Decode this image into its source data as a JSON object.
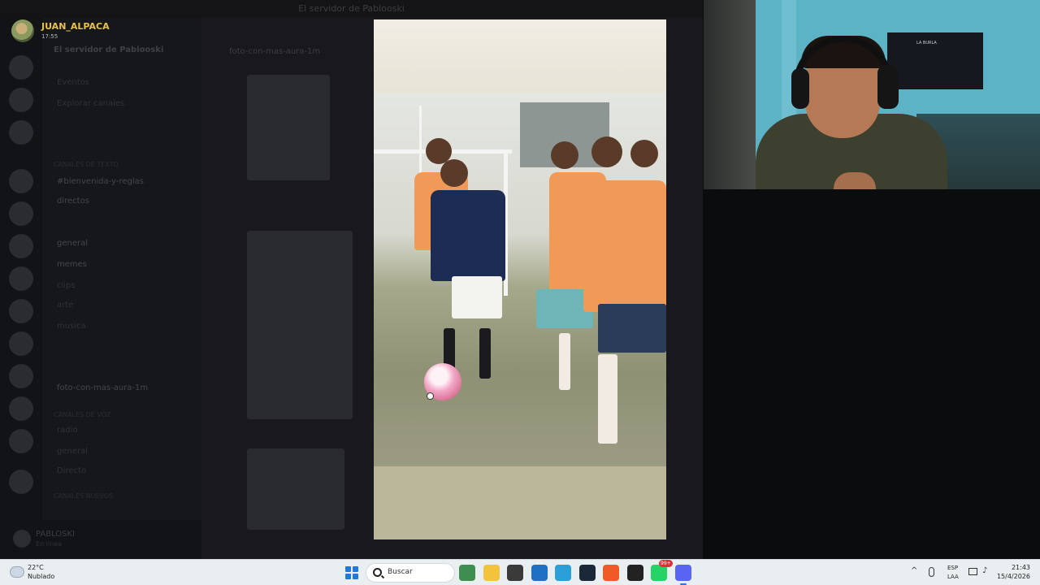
{
  "window": {
    "title": "El servidor de Pablooski"
  },
  "overlay_user": {
    "name": "JUAN_ALPACA",
    "time": "17:55"
  },
  "discord": {
    "server_name": "El servidor de Pablooski",
    "thread_title": "foto-con-mas-aura-1m",
    "categories": [
      "Canales de texto",
      "Canales de voz",
      "Canales nuevos"
    ],
    "channels": [
      {
        "label": "Eventos",
        "bright": false
      },
      {
        "label": "Explorar canales",
        "bright": false
      },
      {
        "label": "#bienvenida-y-reglas",
        "bright": true
      },
      {
        "label": "directos",
        "bright": true
      },
      {
        "label": "general",
        "bright": true
      },
      {
        "label": "memes",
        "bright": true
      },
      {
        "label": "clips",
        "bright": false
      },
      {
        "label": "arte",
        "bright": false
      },
      {
        "label": "musica",
        "bright": false
      },
      {
        "label": "foto-con-mas-aura-1m",
        "bright": true
      },
      {
        "label": "radio",
        "bright": false
      },
      {
        "label": "general",
        "bright": false
      },
      {
        "label": "Directo",
        "bright": false
      }
    ],
    "user": {
      "name": "PABLOSKI",
      "status": "En línea"
    }
  },
  "photo_viewer": {
    "scene": "youth soccer match photo",
    "colors": {
      "bib_orange": "#f19a58",
      "kit_navy": "#1d2c52",
      "field_green": "#8e9174"
    }
  },
  "webcam": {
    "flag_text": "LA BURLA"
  },
  "taskbar": {
    "weather": {
      "temp": "22°C",
      "desc": "Nublado"
    },
    "search_placeholder": "Buscar",
    "apps": [
      {
        "name": "trees-widget-icon",
        "color": "#3e8f4f"
      },
      {
        "name": "file-explorer-icon",
        "color": "#f3c33c"
      },
      {
        "name": "terminal-icon",
        "color": "#3a3a3a"
      },
      {
        "name": "store-icon",
        "color": "#1f6fc5"
      },
      {
        "name": "vpn-icon",
        "color": "#2ba0d8"
      },
      {
        "name": "steam-icon",
        "color": "#1b2838"
      },
      {
        "name": "brave-icon",
        "color": "#f05a24"
      },
      {
        "name": "obs-icon",
        "color": "#222222"
      },
      {
        "name": "whatsapp-icon",
        "color": "#25d366"
      },
      {
        "name": "discord-icon",
        "color": "#5865f2"
      }
    ],
    "whatsapp_badge": "99+",
    "tray": {
      "lang_line1": "ESP",
      "lang_line2": "LAA",
      "time": "21:43",
      "date": "15/4/2026"
    }
  }
}
